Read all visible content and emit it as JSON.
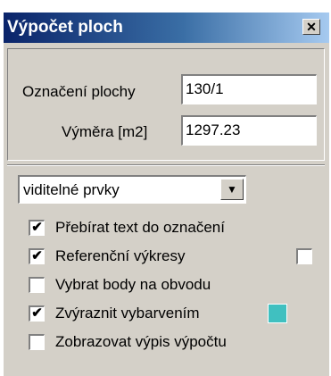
{
  "window": {
    "title": "Výpočet ploch",
    "close_symbol": "✕"
  },
  "form": {
    "oznaceni_label": "Označení plochy",
    "oznaceni_value": "130/1",
    "vymera_label": "Výměra [m2]",
    "vymera_value": "1297.23"
  },
  "combo": {
    "selected": "viditelné prvky",
    "arrow": "▼"
  },
  "options": [
    {
      "label": "Přebírat text do označení",
      "checked": true,
      "mark": "✔"
    },
    {
      "label": "Referenční výkresy",
      "checked": true,
      "mark": "✔"
    },
    {
      "label": "Vybrat body na obvodu",
      "checked": false,
      "mark": ""
    },
    {
      "label": "Zvýraznit vybarvením",
      "checked": true,
      "mark": "✔"
    },
    {
      "label": "Zobrazovat výpis výpočtu",
      "checked": false,
      "mark": ""
    }
  ],
  "highlight_color": "#40c0c0"
}
